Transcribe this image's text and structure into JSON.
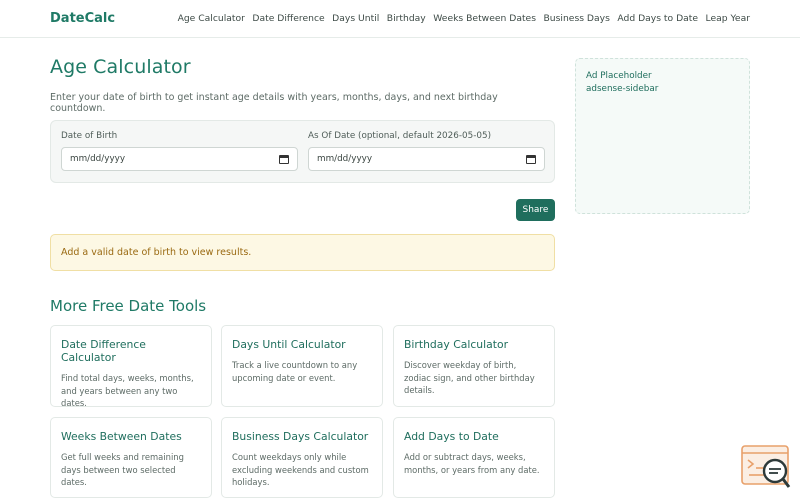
{
  "header": {
    "brand": "DateCalc",
    "nav": [
      "Age Calculator",
      "Date Difference",
      "Days Until",
      "Birthday",
      "Weeks Between Dates",
      "Business Days",
      "Add Days to Date",
      "Leap Year"
    ]
  },
  "main": {
    "title": "Age Calculator",
    "lead": "Enter your date of birth to get instant age details with years, months, days, and next birthday countdown.",
    "form": {
      "dob_label": "Date of Birth",
      "dob_placeholder": "mm/dd/yyyy",
      "asof_label": "As Of Date (optional, default 2026-05-05)",
      "asof_placeholder": "mm/dd/yyyy"
    },
    "share_label": "Share",
    "alert": "Add a valid date of birth to view results.",
    "tools_title": "More Free Date Tools",
    "tools": [
      {
        "title": "Date Difference Calculator",
        "desc": "Find total days, weeks, months, and years between any two dates."
      },
      {
        "title": "Days Until Calculator",
        "desc": "Track a live countdown to any upcoming date or event."
      },
      {
        "title": "Birthday Calculator",
        "desc": "Discover weekday of birth, zodiac sign, and other birthday details."
      },
      {
        "title": "Weeks Between Dates",
        "desc": "Get full weeks and remaining days between two selected dates."
      },
      {
        "title": "Business Days Calculator",
        "desc": "Count weekdays only while excluding weekends and custom holidays."
      },
      {
        "title": "Add Days to Date",
        "desc": "Add or subtract days, weeks, months, or years from any date."
      }
    ]
  },
  "sidebar": {
    "ad_line1": "Ad Placeholder",
    "ad_line2": "adsense-sidebar"
  },
  "colors": {
    "accent": "#1f7a66",
    "button": "#1f6e5d",
    "alert_bg": "#fdf8e4",
    "alert_text": "#9a6a12"
  },
  "icons": {
    "calendar": "calendar-icon",
    "help": "chat-search-icon"
  }
}
